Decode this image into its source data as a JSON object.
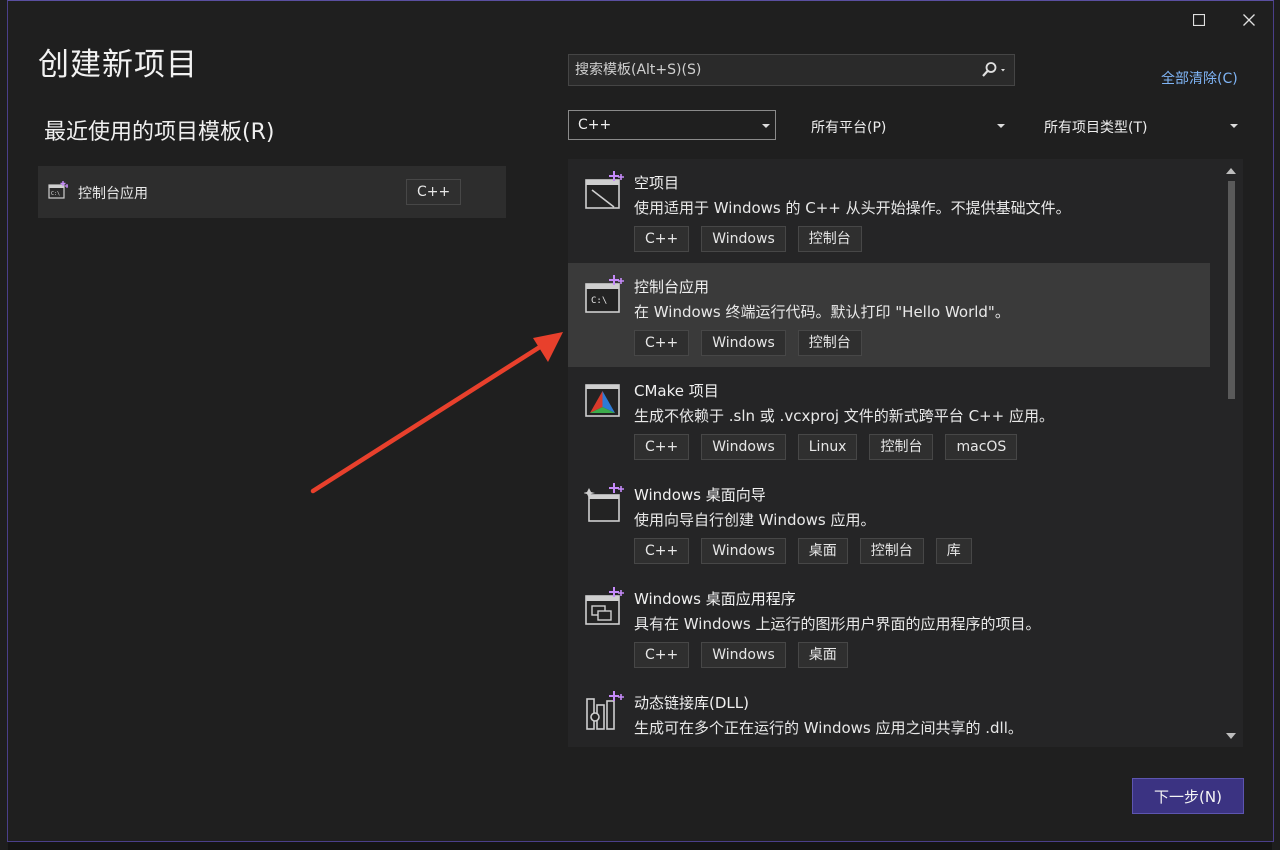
{
  "dialog": {
    "title": "创建新项目",
    "recent_heading": "最近使用的项目模板(R)",
    "recent_items": [
      {
        "label": "控制台应用",
        "tag": "C++",
        "icon": "console-app-icon"
      }
    ]
  },
  "search": {
    "placeholder": "搜索模板(Alt+S)(S)",
    "icon": "search-icon"
  },
  "clear_all_label": "全部清除(C)",
  "filters": {
    "language": "C++",
    "platform": "所有平台(P)",
    "project_type": "所有项目类型(T)"
  },
  "templates": [
    {
      "name": "空项目",
      "description": "使用适用于 Windows 的 C++ 从头开始操作。不提供基础文件。",
      "tags": [
        "C++",
        "Windows",
        "控制台"
      ],
      "icon": "empty-project-icon"
    },
    {
      "name": "控制台应用",
      "description": "在 Windows 终端运行代码。默认打印 \"Hello World\"。",
      "tags": [
        "C++",
        "Windows",
        "控制台"
      ],
      "icon": "console-app-icon",
      "selected": true
    },
    {
      "name": "CMake 项目",
      "description": "生成不依赖于 .sln 或 .vcxproj 文件的新式跨平台 C++ 应用。",
      "tags": [
        "C++",
        "Windows",
        "Linux",
        "控制台",
        "macOS"
      ],
      "icon": "cmake-icon"
    },
    {
      "name": "Windows 桌面向导",
      "description": "使用向导自行创建 Windows 应用。",
      "tags": [
        "C++",
        "Windows",
        "桌面",
        "控制台",
        "库"
      ],
      "icon": "desktop-wizard-icon"
    },
    {
      "name": "Windows 桌面应用程序",
      "description": "具有在 Windows 上运行的图形用户界面的应用程序的项目。",
      "tags": [
        "C++",
        "Windows",
        "桌面"
      ],
      "icon": "desktop-app-icon"
    },
    {
      "name": "动态链接库(DLL)",
      "description": "生成可在多个正在运行的 Windows 应用之间共享的 .dll。",
      "tags": [],
      "icon": "dll-icon"
    }
  ],
  "next_button_label": "下一步(N)",
  "colors": {
    "accent": "#3b3382",
    "link": "#7fb4f5",
    "annotation_arrow": "#e8402c"
  }
}
